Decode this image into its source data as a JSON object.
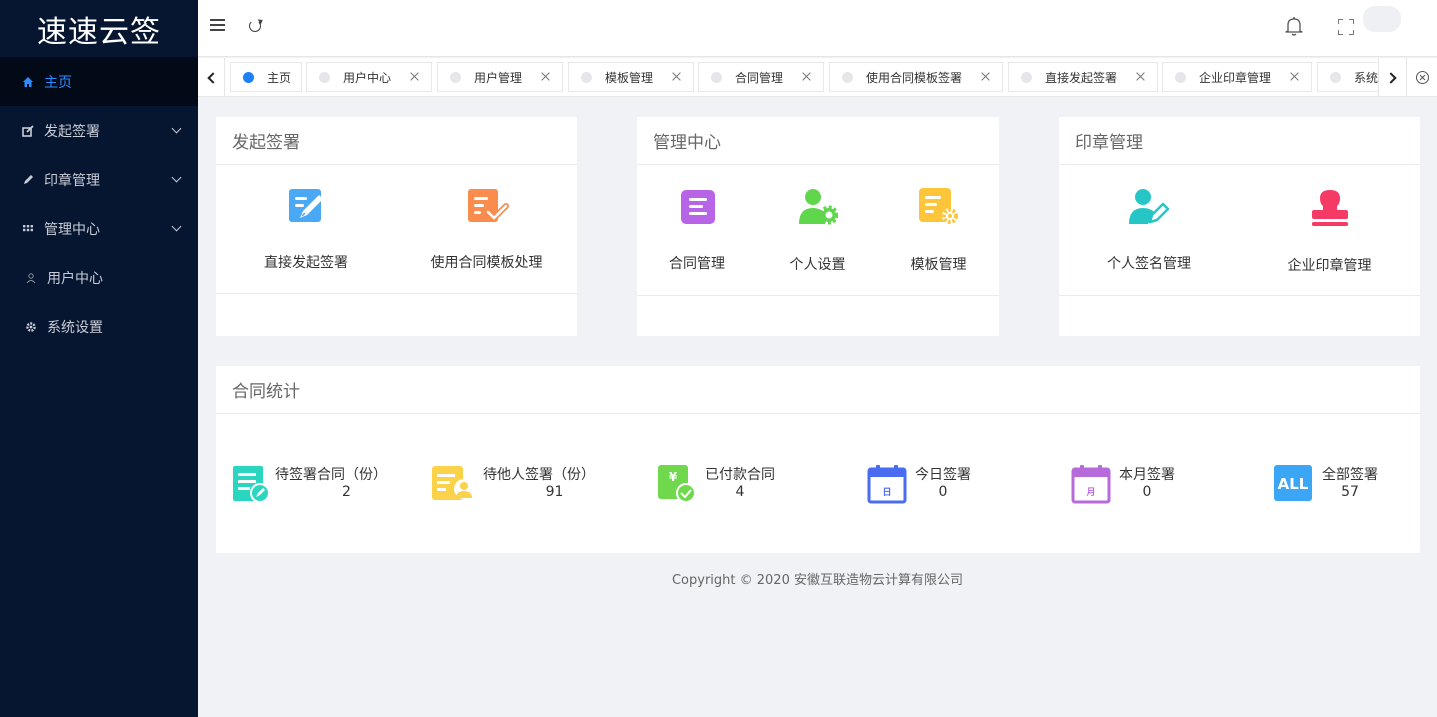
{
  "app": {
    "logo_text": "速速云签"
  },
  "sidebar": {
    "items": [
      {
        "label": "主页",
        "icon": "home-icon"
      },
      {
        "label": "发起签署",
        "icon": "edit-icon"
      },
      {
        "label": "印章管理",
        "icon": "pen-icon"
      },
      {
        "label": "管理中心",
        "icon": "grid-icon"
      },
      {
        "label": "用户中心",
        "icon": "user-icon"
      },
      {
        "label": "系统设置",
        "icon": "gear-icon"
      }
    ]
  },
  "tabs": [
    {
      "label": "主页",
      "active": true
    },
    {
      "label": "用户中心"
    },
    {
      "label": "用户管理"
    },
    {
      "label": "模板管理"
    },
    {
      "label": "合同管理"
    },
    {
      "label": "使用合同模板签署"
    },
    {
      "label": "直接发起签署"
    },
    {
      "label": "企业印章管理"
    },
    {
      "label": "系统"
    }
  ],
  "cards": {
    "initiate": {
      "title": "发起签署",
      "items": [
        {
          "label": "直接发起签署",
          "icon": "sign-document-icon",
          "color": "#4aa8f5"
        },
        {
          "label": "使用合同模板处理",
          "icon": "template-check-icon",
          "color": "#fa8c4e"
        }
      ]
    },
    "manage": {
      "title": "管理中心",
      "items": [
        {
          "label": "合同管理",
          "icon": "contract-icon",
          "color": "#b765e6"
        },
        {
          "label": "个人设置",
          "icon": "user-gear-icon",
          "color": "#5fd64c"
        },
        {
          "label": "模板管理",
          "icon": "template-gear-icon",
          "color": "#fcc53a"
        }
      ]
    },
    "seal": {
      "title": "印章管理",
      "items": [
        {
          "label": "个人签名管理",
          "icon": "user-sign-icon",
          "color": "#26c6c6"
        },
        {
          "label": "企业印章管理",
          "icon": "stamp-icon",
          "color": "#f53a66"
        }
      ]
    }
  },
  "stats": {
    "title": "合同统计",
    "items": [
      {
        "label": "待签署合同（份）",
        "value": "2",
        "icon": "pending-contract-icon",
        "color": "#2bd6c0"
      },
      {
        "label": "待他人签署（份）",
        "value": "91",
        "icon": "waiting-others-icon",
        "color": "#fcd24a"
      },
      {
        "label": "已付款合同",
        "value": "4",
        "icon": "paid-contract-icon",
        "color": "#6fd84c"
      },
      {
        "label": "今日签署",
        "value": "0",
        "icon": "calendar-day-icon",
        "color": "#4a6cf0",
        "glyph": "日"
      },
      {
        "label": "本月签署",
        "value": "0",
        "icon": "calendar-month-icon",
        "color": "#b76bdb",
        "glyph": "月"
      },
      {
        "label": "全部签署",
        "value": "57",
        "icon": "all-icon",
        "color": "#3aa6f5",
        "glyph": "ALL"
      }
    ]
  },
  "footer": {
    "copyright": "Copyright © 2020 安徽互联造物云计算有限公司"
  }
}
